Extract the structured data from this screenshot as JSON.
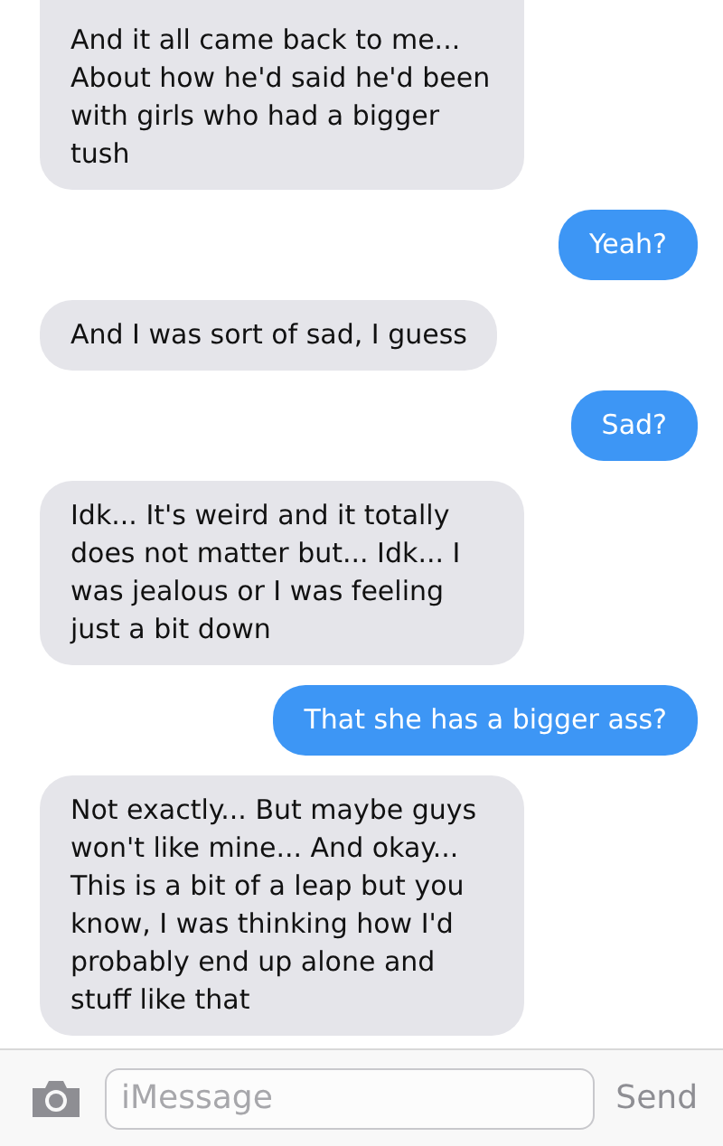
{
  "messages": [
    {
      "sent": false,
      "text": "And it all came back to me... About how he'd said he'd been with girls who had a bigger tush"
    },
    {
      "sent": true,
      "text": "Yeah?"
    },
    {
      "sent": false,
      "text": "And I was sort of sad, I guess"
    },
    {
      "sent": true,
      "text": "Sad?"
    },
    {
      "sent": false,
      "text": "Idk... It's weird and it totally does not matter but... Idk... I was jealous or I was feeling just a bit down"
    },
    {
      "sent": true,
      "text": "That she has a bigger ass?"
    },
    {
      "sent": false,
      "text": "Not exactly... But maybe guys won't like mine... And okay... This is a bit of a leap but you know, I was thinking how I'd probably end up alone and stuff like that"
    }
  ],
  "composer": {
    "placeholder": "iMessage",
    "send_label": "Send"
  }
}
